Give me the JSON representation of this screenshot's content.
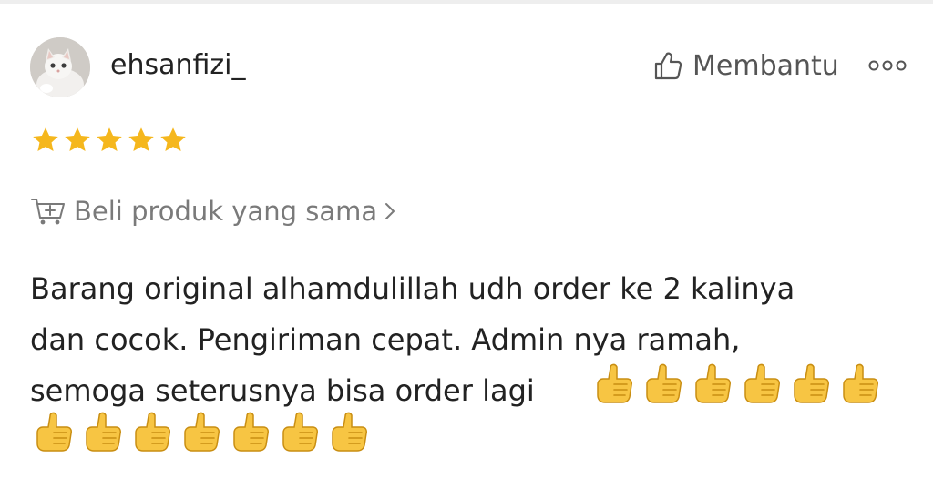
{
  "review": {
    "username": "ehsanfizi_",
    "helpful_label": "Membantu",
    "rating": 5,
    "max_rating": 5,
    "buy_same_label": "Beli produk yang sama",
    "text_line1": "Barang original alhamdulillah udh order ke 2 kalinya",
    "text_line2": "dan cocok. Pengiriman cepat. Admin nya ramah,",
    "text_line3": "semoga seterusnya bisa order lagi",
    "thumbs_up_emoji_count": 13
  },
  "icons": {
    "helpful": "thumbs-up-outline-icon",
    "more": "more-options-icon",
    "star": "star-icon",
    "cart": "add-to-cart-icon",
    "chevron": "chevron-right-icon",
    "emoji": "thumbs-up-emoji"
  },
  "colors": {
    "star": "#F5B71D",
    "username": "#222222",
    "secondary_text": "#7a7a7a",
    "emoji": "#F7C543"
  }
}
